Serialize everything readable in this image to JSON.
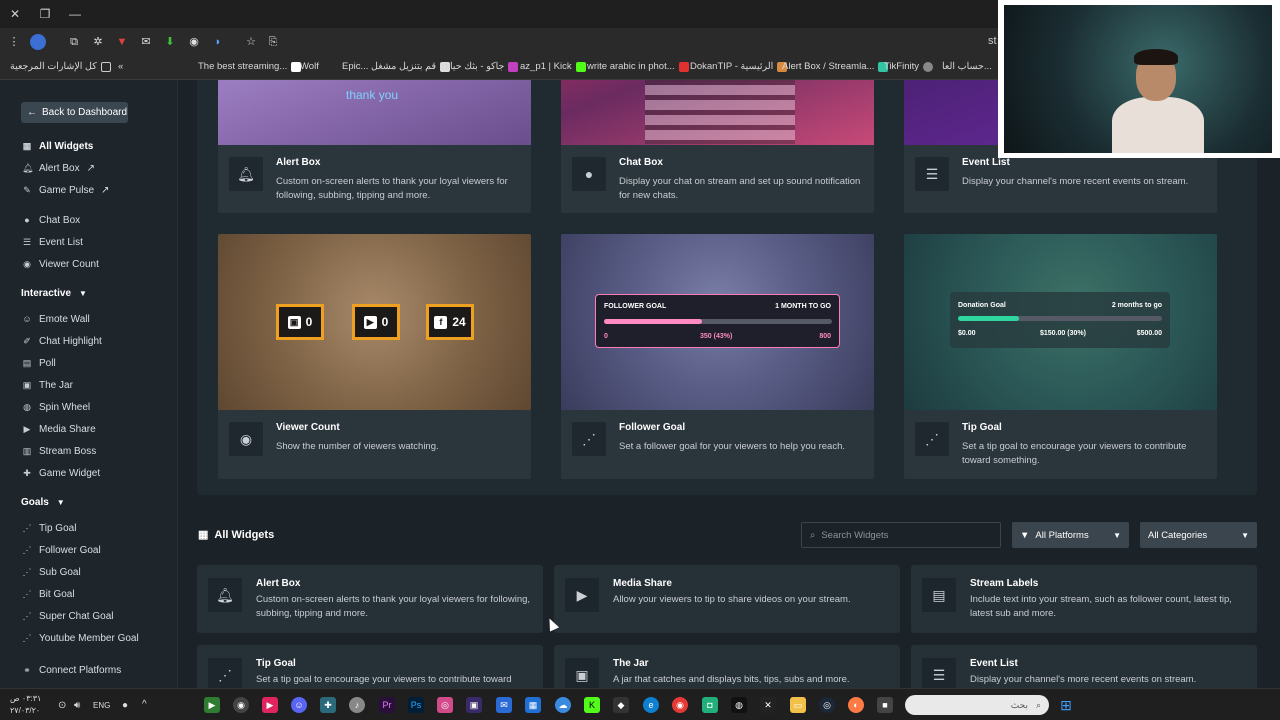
{
  "browser": {
    "url_tail": "st",
    "bookmarks": [
      {
        "label": "كل الإشارات المرجعية"
      },
      {
        "label": "The best streaming..."
      },
      {
        "label": "Wolf"
      },
      {
        "label": "Epic... قم بتنزيل مشغل"
      },
      {
        "label": "جاكو - بثك حياة"
      },
      {
        "label": "az_p1 | Kick"
      },
      {
        "label": "write arabic in phot..."
      },
      {
        "label": "DokanTIP - الرئيسية"
      },
      {
        "label": "Alert Box / Streamla..."
      },
      {
        "label": "TikFinity"
      },
      {
        "label": "حساب العا..."
      }
    ]
  },
  "sidebar": {
    "back_label": "Back to Dashboard",
    "items_top": [
      {
        "label": "All Widgets",
        "icon": "grid-icon"
      },
      {
        "label": "Alert Box",
        "icon": "bell-icon"
      },
      {
        "label": "Game Pulse",
        "icon": "pulse-icon"
      },
      {
        "label": "Chat Box",
        "icon": "chat-icon"
      },
      {
        "label": "Event List",
        "icon": "list-icon"
      },
      {
        "label": "Viewer Count",
        "icon": "eye-icon"
      }
    ],
    "interactive_head": "Interactive",
    "interactive": [
      {
        "label": "Emote Wall"
      },
      {
        "label": "Chat Highlight"
      },
      {
        "label": "Poll"
      },
      {
        "label": "The Jar"
      },
      {
        "label": "Spin Wheel"
      },
      {
        "label": "Media Share"
      },
      {
        "label": "Stream Boss"
      },
      {
        "label": "Game Widget"
      }
    ],
    "goals_head": "Goals",
    "goals": [
      {
        "label": "Tip Goal"
      },
      {
        "label": "Follower Goal"
      },
      {
        "label": "Sub Goal"
      },
      {
        "label": "Bit Goal"
      },
      {
        "label": "Super Chat Goal"
      },
      {
        "label": "Youtube Member Goal"
      }
    ],
    "connect": "Connect Platforms"
  },
  "featured": [
    {
      "title": "Alert Box",
      "desc": "Custom on-screen alerts to thank your loyal viewers for following, subbing, tipping and more.",
      "icon": "bell-icon",
      "thumb_text": "thank you"
    },
    {
      "title": "Chat Box",
      "desc": "Display your chat on stream and set up sound notification for new chats.",
      "icon": "chat-icon"
    },
    {
      "title": "Event List",
      "desc": "Display your channel's more recent events on stream.",
      "icon": "list-icon"
    },
    {
      "title": "Viewer Count",
      "desc": "Show the number of viewers watching.",
      "icon": "eye-icon",
      "badges": [
        "0",
        "0",
        "24"
      ]
    },
    {
      "title": "Follower Goal",
      "desc": "Set a follower goal for your viewers to help you reach.",
      "icon": "goal-icon",
      "goal": {
        "label": "FOLLOWER GOAL",
        "time": "1 MONTH TO GO",
        "start": "0",
        "mid": "350 (43%)",
        "end": "800",
        "pct": 0.43
      }
    },
    {
      "title": "Tip Goal",
      "desc": "Set a tip goal to encourage your viewers to contribute toward something.",
      "icon": "goal-icon",
      "goal": {
        "label": "Donation Goal",
        "time": "2 months to go",
        "start": "$0.00",
        "mid": "$150.00 (30%)",
        "end": "$500.00",
        "pct": 0.3
      }
    }
  ],
  "all_widgets": {
    "title": "All Widgets",
    "search_placeholder": "Search Widgets",
    "platforms": "All Platforms",
    "categories": "All Categories",
    "items": [
      {
        "title": "Alert Box",
        "desc": "Custom on-screen alerts to thank your loyal viewers for following, subbing, tipping and more.",
        "icon": "bell-icon"
      },
      {
        "title": "Media Share",
        "desc": "Allow your viewers to tip to share videos on your stream.",
        "icon": "play-icon"
      },
      {
        "title": "Stream Labels",
        "desc": "Include text into your stream, such as follower count, latest tip, latest sub and more.",
        "icon": "file-icon"
      },
      {
        "title": "Tip Goal",
        "desc": "Set a tip goal to encourage your viewers to contribute toward",
        "icon": "goal-icon"
      },
      {
        "title": "The Jar",
        "desc": "A jar that catches and displays bits, tips, subs and more.",
        "icon": "jar-icon"
      },
      {
        "title": "Event List",
        "desc": "Display your channel's more recent events on stream.",
        "icon": "list-icon"
      }
    ]
  },
  "taskbar": {
    "time": "٠٣:٣١ ص",
    "date": "٢٧/٠٣/٢٠",
    "lang": "ENG",
    "search": "بحث"
  }
}
